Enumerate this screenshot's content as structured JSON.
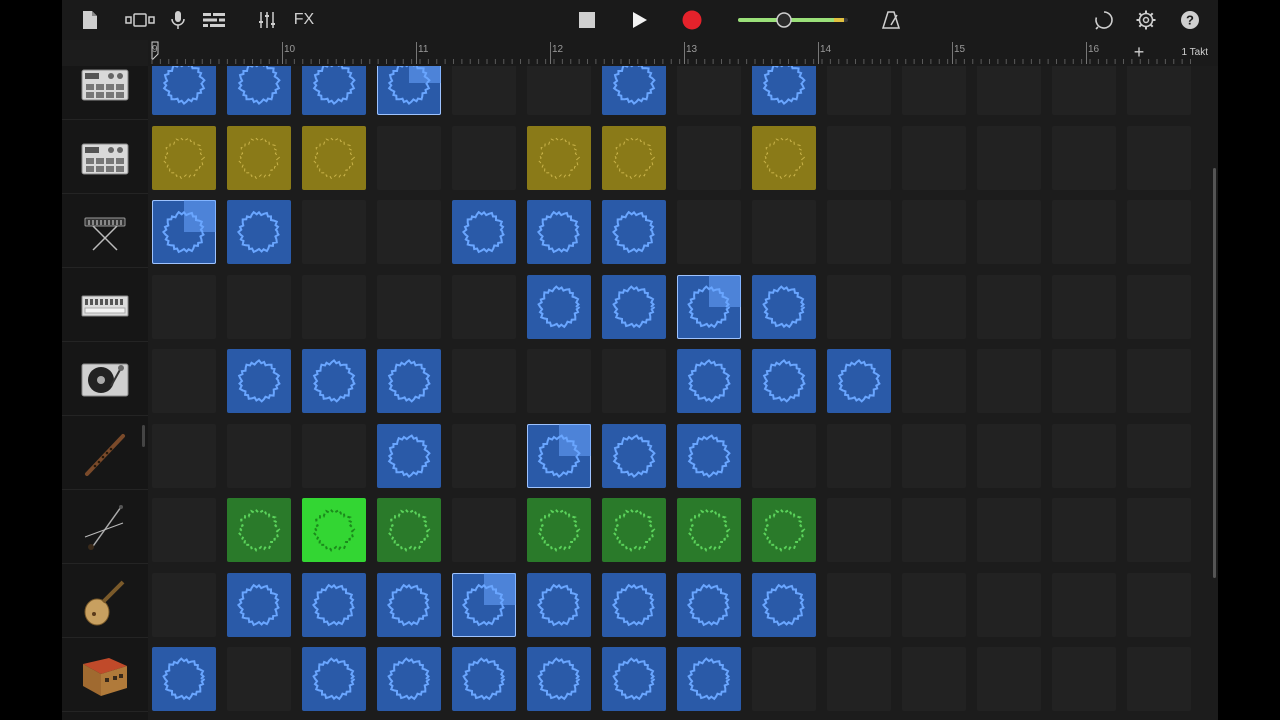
{
  "toolbar": {
    "fx_label": "FX",
    "icons": [
      "document-icon",
      "view-toggle-icon",
      "microphone-icon",
      "tracks-icon",
      "mixer-icon",
      "stop-icon",
      "play-icon",
      "record-icon",
      "metronome-icon",
      "loop-icon",
      "settings-icon",
      "help-icon"
    ],
    "record_color": "#e5222b",
    "volume_color": "#9be07a"
  },
  "ruler": {
    "bars": [
      "9",
      "10",
      "11",
      "12",
      "13",
      "14",
      "15",
      "16"
    ],
    "zoom_label": "1 Takt",
    "add_label": "+"
  },
  "tracks": [
    {
      "name": "drum-machine-1",
      "icon": "drum-machine-icon"
    },
    {
      "name": "drum-machine-2",
      "icon": "drum-machine-icon"
    },
    {
      "name": "keyboard",
      "icon": "keyboard-icon"
    },
    {
      "name": "synth",
      "icon": "synth-icon"
    },
    {
      "name": "turntable",
      "icon": "turntable-icon"
    },
    {
      "name": "flute",
      "icon": "flute-icon"
    },
    {
      "name": "erhu",
      "icon": "erhu-icon"
    },
    {
      "name": "pipa",
      "icon": "pipa-icon"
    },
    {
      "name": "guzheng",
      "icon": "guzheng-icon"
    }
  ],
  "grid": [
    [
      "blue",
      "blue",
      "blue",
      "blue-sel",
      "empty",
      "empty",
      "blue",
      "empty",
      "blue",
      "empty",
      "empty",
      "empty",
      "empty",
      "empty"
    ],
    [
      "yellow",
      "yellow",
      "yellow",
      "empty",
      "empty",
      "yellow",
      "yellow",
      "empty",
      "yellow",
      "empty",
      "empty",
      "empty",
      "empty",
      "empty"
    ],
    [
      "blue-sel",
      "blue",
      "empty",
      "empty",
      "blue",
      "blue",
      "blue",
      "empty",
      "empty",
      "empty",
      "empty",
      "empty",
      "empty",
      "empty"
    ],
    [
      "empty",
      "empty",
      "empty",
      "empty",
      "empty",
      "blue",
      "blue",
      "blue-sel",
      "blue",
      "empty",
      "empty",
      "empty",
      "empty",
      "empty"
    ],
    [
      "empty",
      "blue",
      "blue",
      "blue",
      "empty",
      "empty",
      "empty",
      "blue",
      "blue",
      "blue",
      "empty",
      "empty",
      "empty",
      "empty"
    ],
    [
      "empty",
      "empty",
      "empty",
      "blue",
      "empty",
      "blue-sel",
      "blue",
      "blue",
      "empty",
      "empty",
      "empty",
      "empty",
      "empty",
      "empty"
    ],
    [
      "empty",
      "green",
      "brightgreen",
      "green",
      "empty",
      "green",
      "green",
      "green",
      "green",
      "empty",
      "empty",
      "empty",
      "empty",
      "empty"
    ],
    [
      "empty",
      "blue",
      "blue",
      "blue",
      "blue-sel",
      "blue",
      "blue",
      "blue",
      "blue",
      "empty",
      "empty",
      "empty",
      "empty",
      "empty"
    ],
    [
      "blue",
      "empty",
      "blue",
      "blue",
      "blue",
      "blue",
      "blue",
      "blue",
      "empty",
      "empty",
      "empty",
      "empty",
      "empty",
      "empty"
    ]
  ]
}
